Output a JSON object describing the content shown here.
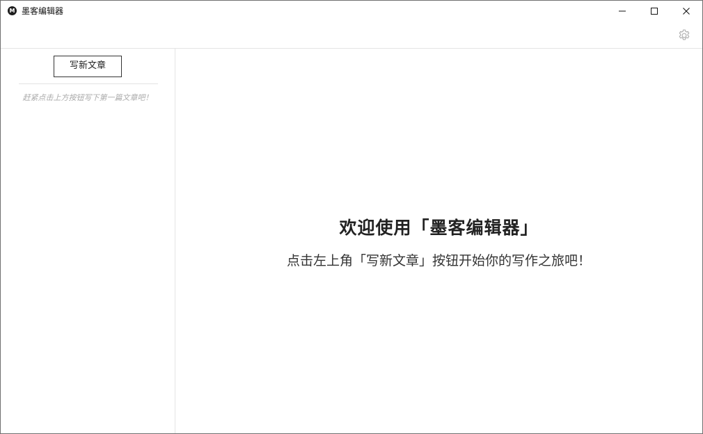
{
  "window": {
    "title": "墨客编辑器",
    "logo_letter": "M"
  },
  "sidebar": {
    "new_article_label": "写新文章",
    "empty_hint": "赶紧点击上方按钮写下第一篇文章吧！"
  },
  "main": {
    "welcome_title": "欢迎使用「墨客编辑器」",
    "welcome_subtitle": "点击左上角「写新文章」按钮开始你的写作之旅吧！"
  },
  "icons": {
    "settings": "gear-icon",
    "minimize": "minimize-icon",
    "maximize": "maximize-icon",
    "close": "close-icon"
  }
}
